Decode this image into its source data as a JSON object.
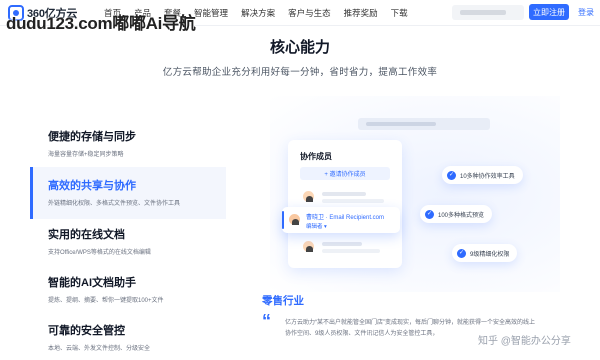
{
  "watermark": "dudu123.com嘟嘟Ai导航",
  "header": {
    "logo_text": "360亿方云",
    "nav": [
      "首页",
      "产品",
      "套餐",
      "智能管理",
      "解决方案",
      "客户与生态",
      "推荐奖励",
      "下载"
    ],
    "register_label": "立即注册",
    "login_label": "登录"
  },
  "hero": {
    "title": "核心能力",
    "subtitle": "亿方云帮助企业充分利用好每一分钟，省时省力，提高工作效率"
  },
  "features": [
    {
      "title": "便捷的存储与同步",
      "desc": "海量容量存储+稳定同步策略",
      "active": false
    },
    {
      "title": "高效的共享与协作",
      "desc": "外链精细化权限、多格式文件预览、文件协作工具",
      "active": true
    },
    {
      "title": "实用的在线文档",
      "desc": "支持Office/WPS等格式的在线文档编辑",
      "active": false
    },
    {
      "title": "智能的AI文档助手",
      "desc": "提炼、提纲、摘要、帮你一键提取100+文件",
      "active": false
    },
    {
      "title": "可靠的安全管控",
      "desc": "本地、云端、外发文件控制、分级安全",
      "active": false
    }
  ],
  "illustration": {
    "panel_title": "协作成员",
    "invite_label": "+ 邀请协作成员",
    "member_name": "曹晓卫 · Email Recipient.com",
    "member_role": "编辑者 ▾",
    "chips": [
      "10多种协作效率工具",
      "100多种格式预览",
      "9级精细化权限"
    ]
  },
  "retail": {
    "title": "零售行业",
    "quote_mark": "“",
    "text": "亿方云助力“某不出户就能管全国门店”变成现实，每后门聊分钟，就能获得一个安全高效的线上协作空间、9级人员权限、文件讯记信人为安全管控工具，"
  },
  "footer_mark": "知乎 @智能办公分享",
  "colors": {
    "accent": "#2f6bff",
    "title_text": "#111827",
    "muted_text": "#6b7280",
    "active_bg": "#f3f6fd"
  }
}
